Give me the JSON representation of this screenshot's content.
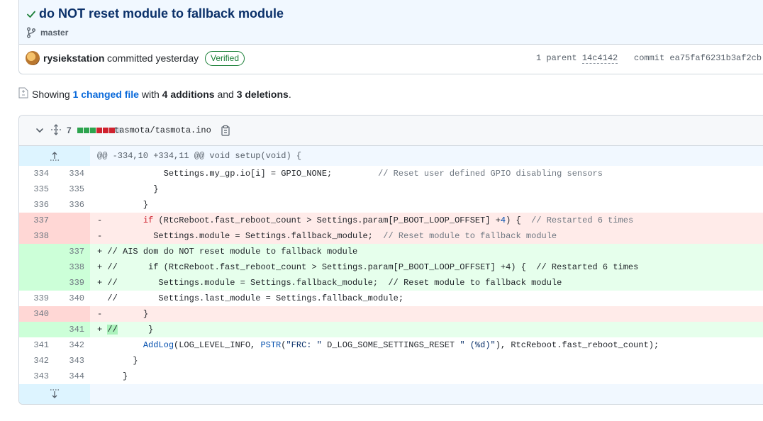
{
  "commit": {
    "title": "do NOT reset module to fallback module",
    "branch": "master",
    "author": "rysiekstation",
    "committed_text": "committed yesterday",
    "verified_label": "Verified",
    "parent_label": "1 parent",
    "parent_sha": "14c4142",
    "commit_label": "commit",
    "commit_sha": "ea75faf6231b3af2cb"
  },
  "summary": {
    "prefix": "Showing",
    "changed_files": "1 changed file",
    "with": "with",
    "additions": "4 additions",
    "and": "and",
    "deletions": "3 deletions",
    "end": "."
  },
  "file": {
    "diff_count": "7",
    "path": "tasmota/tasmota.ino",
    "diffstat": [
      "add",
      "add",
      "add",
      "del",
      "del",
      "del",
      "neutral"
    ],
    "colors": {
      "add": "#2da44e",
      "del": "#cf222e",
      "neutral": "#d0d7de"
    }
  },
  "hunk_header": "@@ -334,10 +334,11 @@ void setup(void) {",
  "lines": [
    {
      "type": "ctx",
      "old": "334",
      "new": "334",
      "text": "             Settings.my_gp.io[i] = GPIO_NONE;         // Reset user defined GPIO disabling sensors"
    },
    {
      "type": "ctx",
      "old": "335",
      "new": "335",
      "text": "           }"
    },
    {
      "type": "ctx",
      "old": "336",
      "new": "336",
      "text": "         }"
    },
    {
      "type": "del",
      "old": "337",
      "new": "",
      "text": "-        if (RtcReboot.fast_reboot_count > Settings.param[P_BOOT_LOOP_OFFSET] +4) {  // Restarted 6 times"
    },
    {
      "type": "del",
      "old": "338",
      "new": "",
      "text": "-          Settings.module = Settings.fallback_module;  // Reset module to fallback module"
    },
    {
      "type": "add",
      "old": "",
      "new": "337",
      "text": "+ // AIS dom do NOT reset module to fallback module"
    },
    {
      "type": "add",
      "old": "",
      "new": "338",
      "text": "+ //      if (RtcReboot.fast_reboot_count > Settings.param[P_BOOT_LOOP_OFFSET] +4) {  // Restarted 6 times"
    },
    {
      "type": "add",
      "old": "",
      "new": "339",
      "text": "+ //        Settings.module = Settings.fallback_module;  // Reset module to fallback module"
    },
    {
      "type": "ctx",
      "old": "339",
      "new": "340",
      "text": "  //        Settings.last_module = Settings.fallback_module;"
    },
    {
      "type": "del",
      "old": "340",
      "new": "",
      "text": "-        }"
    },
    {
      "type": "add",
      "old": "",
      "new": "341",
      "text": "+ //      }"
    },
    {
      "type": "ctx",
      "old": "341",
      "new": "342",
      "text": "         AddLog(LOG_LEVEL_INFO, PSTR(\"FRC: \" D_LOG_SOME_SETTINGS_RESET \" (%d)\"), RtcReboot.fast_reboot_count);"
    },
    {
      "type": "ctx",
      "old": "342",
      "new": "343",
      "text": "       }"
    },
    {
      "type": "ctx",
      "old": "343",
      "new": "344",
      "text": "     }"
    }
  ]
}
